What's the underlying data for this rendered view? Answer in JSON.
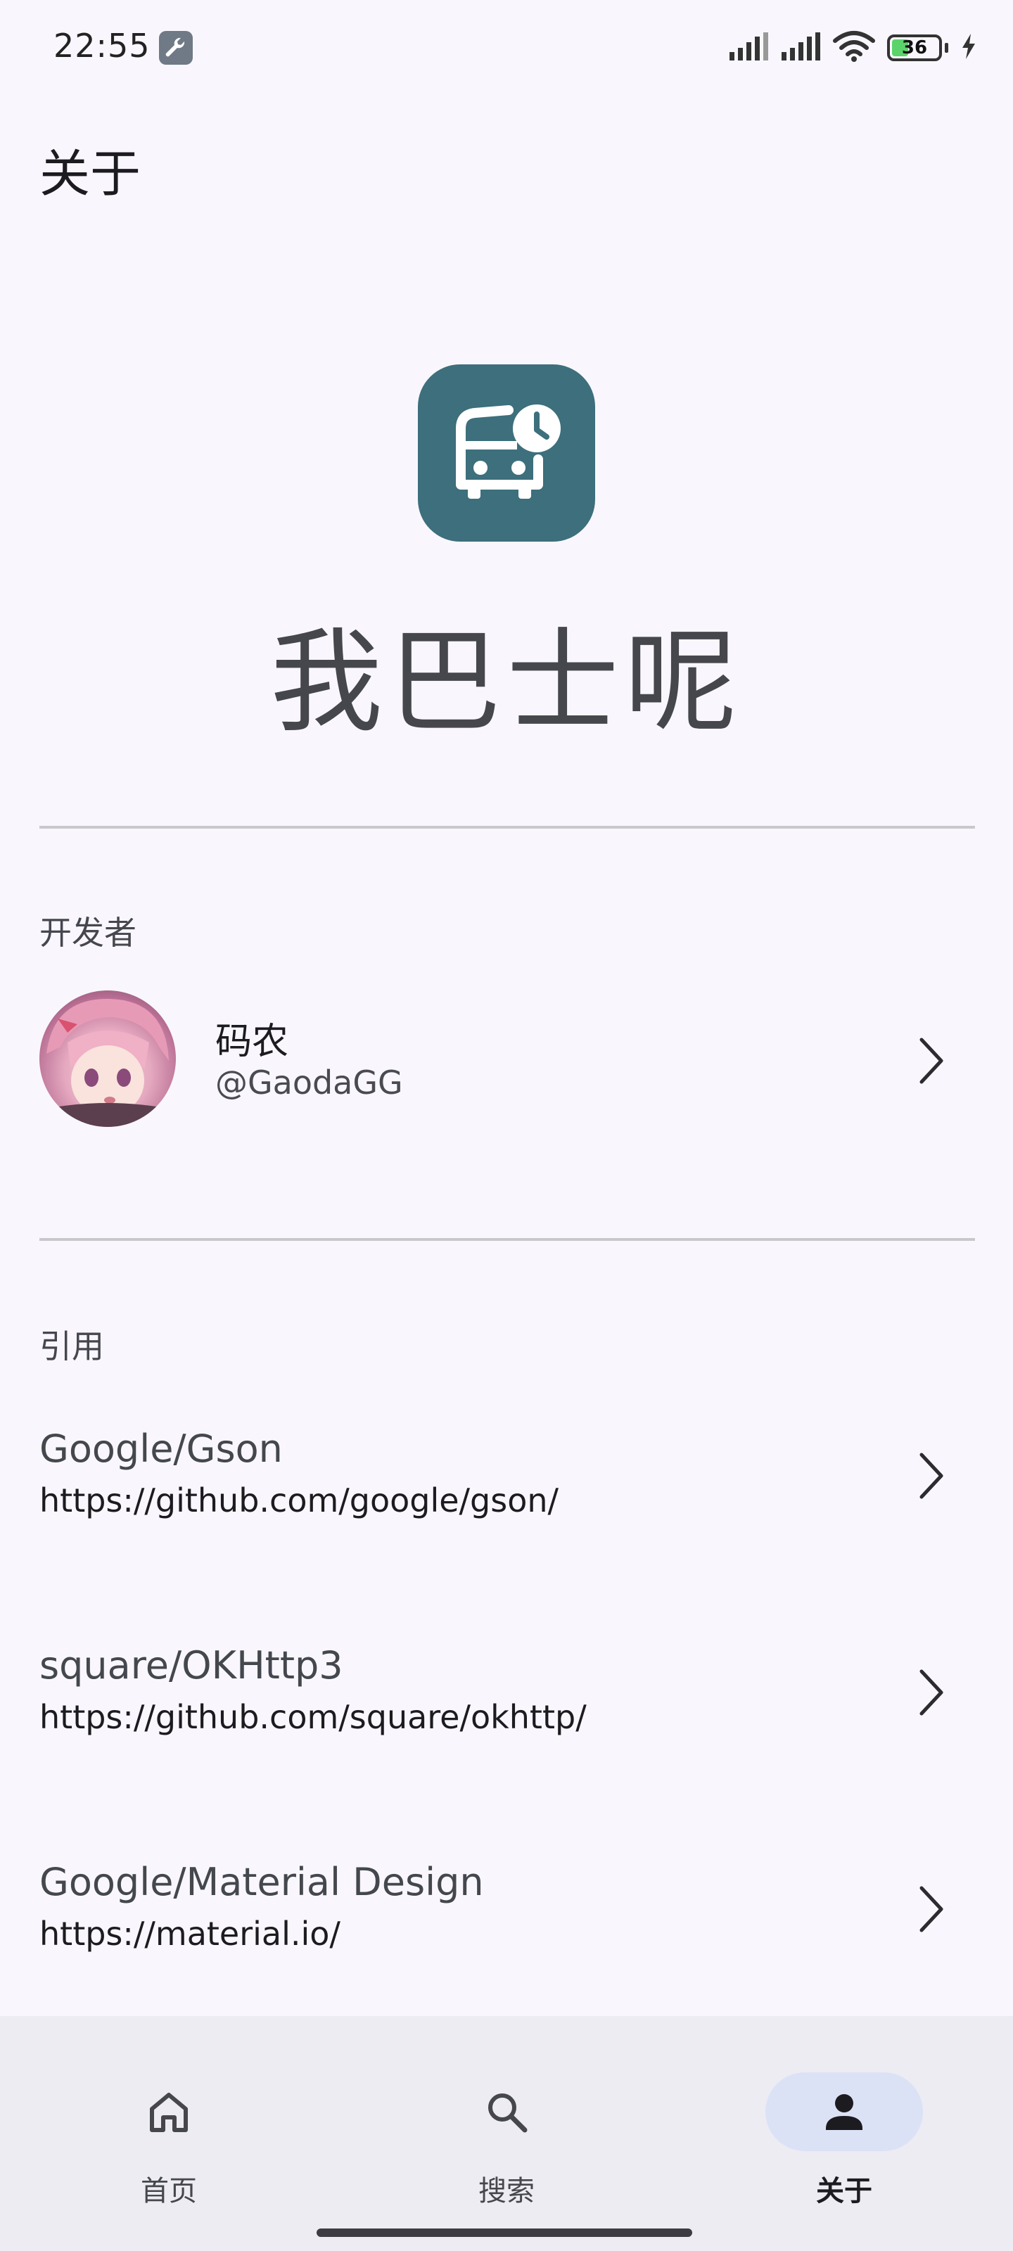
{
  "status_bar": {
    "time": "22:55",
    "battery": "36",
    "battery_level": 0.36,
    "icons": [
      "wrench-icon",
      "signal-icon",
      "signal-icon",
      "wifi-icon",
      "battery-icon",
      "charging-icon"
    ]
  },
  "header": {
    "title": "关于"
  },
  "app": {
    "name": "我巴士呢",
    "icon": "bus-clock-icon",
    "icon_color": "#3d6f7c"
  },
  "developer_section": {
    "label": "开发者",
    "name": "码农",
    "handle": "@GaodaGG"
  },
  "references_section": {
    "label": "引用",
    "items": [
      {
        "title": "Google/Gson",
        "url": "https://github.com/google/gson/"
      },
      {
        "title": "square/OKHttp3",
        "url": "https://github.com/square/okhttp/"
      },
      {
        "title": "Google/Material Design",
        "url": "https://material.io/"
      }
    ]
  },
  "bottom_nav": {
    "items": [
      {
        "label": "首页",
        "icon": "home-icon",
        "active": false
      },
      {
        "label": "搜索",
        "icon": "search-icon",
        "active": false
      },
      {
        "label": "关于",
        "icon": "person-icon",
        "active": true
      }
    ]
  }
}
